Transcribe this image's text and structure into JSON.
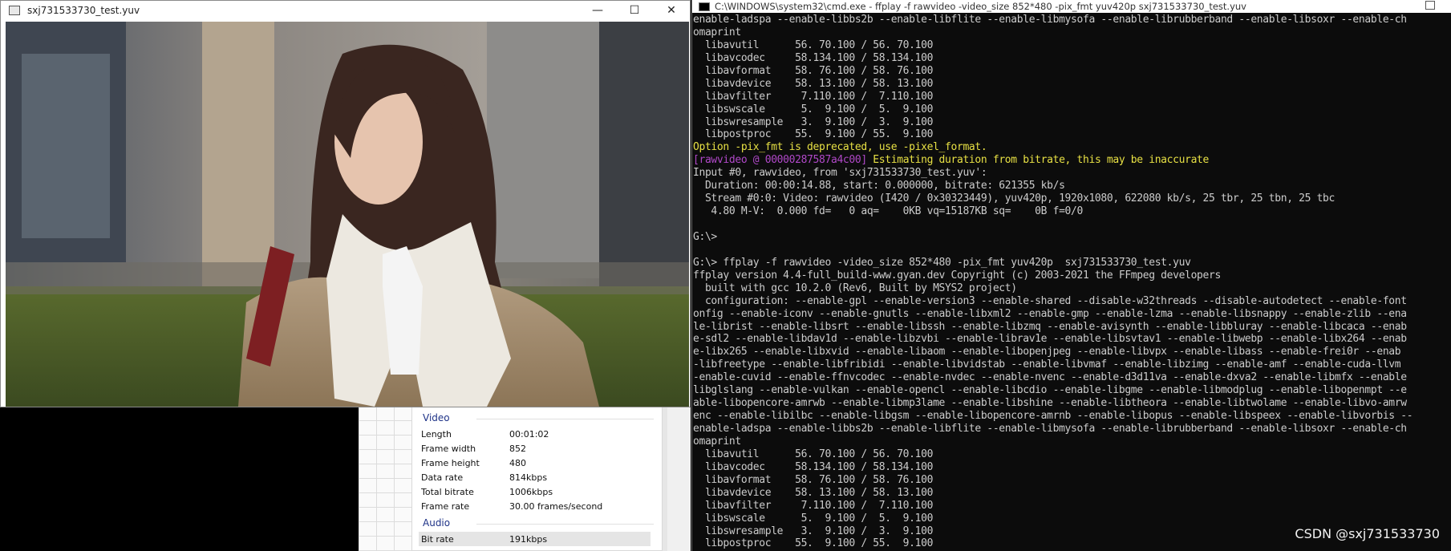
{
  "video_window": {
    "title": "sxj731533730_test.yuv",
    "minimize": "—",
    "maximize": "☐",
    "close": "✕"
  },
  "properties": {
    "video_header": "Video",
    "video_rows": [
      {
        "key": "Length",
        "value": "00:01:02"
      },
      {
        "key": "Frame width",
        "value": "852"
      },
      {
        "key": "Frame height",
        "value": "480"
      },
      {
        "key": "Data rate",
        "value": "814kbps"
      },
      {
        "key": "Total bitrate",
        "value": "1006kbps"
      },
      {
        "key": "Frame rate",
        "value": "30.00 frames/second"
      }
    ],
    "audio_header": "Audio",
    "audio_rows": [
      {
        "key": "Bit rate",
        "value": "191kbps"
      }
    ]
  },
  "cmd": {
    "title": "C:\\WINDOWS\\system32\\cmd.exe - ffplay  -f rawvideo -video_size 852*480 -pix_fmt yuv420p  sxj731533730_test.yuv",
    "lines": [
      "enable-ladspa --enable-libbs2b --enable-libflite --enable-libmysofa --enable-librubberband --enable-libsoxr --enable-ch",
      "omaprint",
      "  libavutil      56. 70.100 / 56. 70.100",
      "  libavcodec     58.134.100 / 58.134.100",
      "  libavformat    58. 76.100 / 58. 76.100",
      "  libavdevice    58. 13.100 / 58. 13.100",
      "  libavfilter     7.110.100 /  7.110.100",
      "  libswscale      5.  9.100 /  5.  9.100",
      "  libswresample   3.  9.100 /  3.  9.100",
      "  libpostproc    55.  9.100 / 55.  9.100",
      "Option -pix_fmt is deprecated, use -pixel_format.",
      "",
      "Input #0, rawvideo, from 'sxj731533730_test.yuv':",
      "  Duration: 00:00:14.88, start: 0.000000, bitrate: 621355 kb/s",
      "  Stream #0:0: Video: rawvideo (I420 / 0x30323449), yuv420p, 1920x1080, 622080 kb/s, 25 tbr, 25 tbn, 25 tbc",
      "   4.80 M-V:  0.000 fd=   0 aq=    0KB vq=15187KB sq=    0B f=0/0",
      "",
      "G:\\>",
      "",
      "G:\\> ffplay -f rawvideo -video_size 852*480 -pix_fmt yuv420p  sxj731533730_test.yuv",
      "ffplay version 4.4-full_build-www.gyan.dev Copyright (c) 2003-2021 the FFmpeg developers",
      "  built with gcc 10.2.0 (Rev6, Built by MSYS2 project)",
      "  configuration: --enable-gpl --enable-version3 --enable-shared --disable-w32threads --disable-autodetect --enable-font",
      "onfig --enable-iconv --enable-gnutls --enable-libxml2 --enable-gmp --enable-lzma --enable-libsnappy --enable-zlib --ena",
      "le-librist --enable-libsrt --enable-libssh --enable-libzmq --enable-avisynth --enable-libbluray --enable-libcaca --enab",
      "e-sdl2 --enable-libdav1d --enable-libzvbi --enable-librav1e --enable-libsvtav1 --enable-libwebp --enable-libx264 --enab",
      "e-libx265 --enable-libxvid --enable-libaom --enable-libopenjpeg --enable-libvpx --enable-libass --enable-frei0r --enab",
      "-libfreetype --enable-libfribidi --enable-libvidstab --enable-libvmaf --enable-libzimg --enable-amf --enable-cuda-llvm",
      "-enable-cuvid --enable-ffnvcodec --enable-nvdec --enable-nvenc --enable-d3d11va --enable-dxva2 --enable-libmfx --enable",
      "libglslang --enable-vulkan --enable-opencl --enable-libcdio --enable-libgme --enable-libmodplug --enable-libopenmpt --e",
      "able-libopencore-amrwb --enable-libmp3lame --enable-libshine --enable-libtheora --enable-libtwolame --enable-libvo-amrw",
      "enc --enable-libilbc --enable-libgsm --enable-libopencore-amrnb --enable-libopus --enable-libspeex --enable-libvorbis --",
      "enable-ladspa --enable-libbs2b --enable-libflite --enable-libmysofa --enable-librubberband --enable-libsoxr --enable-ch",
      "omaprint",
      "  libavutil      56. 70.100 / 56. 70.100",
      "  libavcodec     58.134.100 / 58.134.100",
      "  libavformat    58. 76.100 / 58. 76.100",
      "  libavdevice    58. 13.100 / 58. 13.100",
      "  libavfilter     7.110.100 /  7.110.100",
      "  libswscale      5.  9.100 /  5.  9.100",
      "  libswresample   3.  9.100 /  3.  9.100",
      "  libpostproc    55.  9.100 / 55.  9.100"
    ],
    "rawvideo_tag": "[rawvideo @ 00000287587a4c00]",
    "rawvideo_msg": " Estimating duration from bitrate, this may be inaccurate"
  },
  "watermark": "CSDN @sxj731533730"
}
